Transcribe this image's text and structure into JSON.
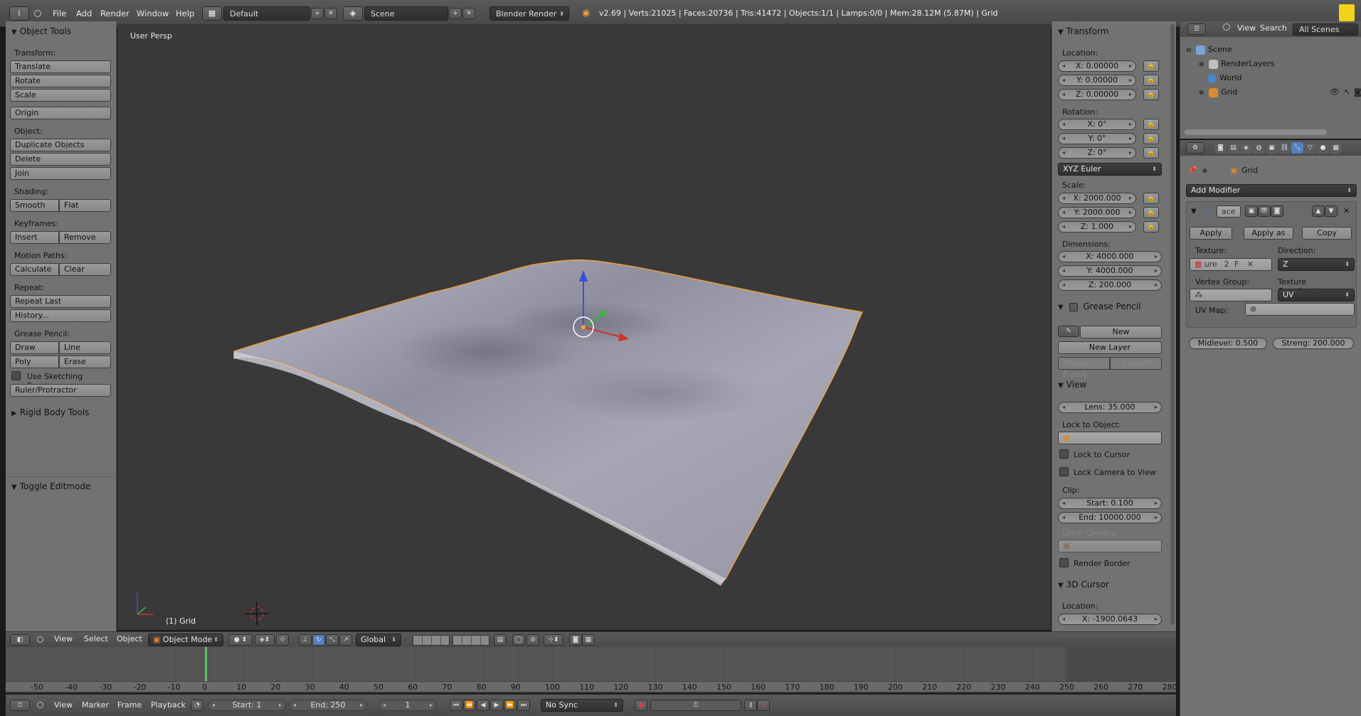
{
  "topbar": {
    "menus": [
      "File",
      "Add",
      "Render",
      "Window",
      "Help"
    ],
    "layout_name": "Default",
    "scene_name": "Scene",
    "render_engine": "Blender Render",
    "stats": "v2.69 | Verts:21025 | Faces:20736 | Tris:41472 | Objects:1/1 | Lamps:0/0 | Mem:28.12M (5.87M) | Grid"
  },
  "left_tools": {
    "title": "Object Tools",
    "transform_label": "Transform:",
    "translate": "Translate",
    "rotate": "Rotate",
    "scale": "Scale",
    "origin": "Origin",
    "object_label": "Object:",
    "duplicate": "Duplicate Objects",
    "delete": "Delete",
    "join": "Join",
    "shading_label": "Shading:",
    "smooth": "Smooth",
    "flat": "Flat",
    "keyframes_label": "Keyframes:",
    "insert": "Insert",
    "remove": "Remove",
    "motion_label": "Motion Paths:",
    "calculate": "Calculate",
    "clear": "Clear",
    "repeat_label": "Repeat:",
    "repeat_last": "Repeat Last",
    "history": "History...",
    "grease_label": "Grease Pencil:",
    "draw": "Draw",
    "line": "Line",
    "poly": "Poly",
    "erase": "Erase",
    "sketching": "Use Sketching Sessions",
    "ruler": "Ruler/Protractor",
    "rigid_body": "Rigid Body Tools",
    "toggle_editmode": "Toggle Editmode"
  },
  "viewport": {
    "label": "User Persp",
    "object": "(1) Grid"
  },
  "transform": {
    "title": "Transform",
    "location_label": "Location:",
    "loc": [
      "X: 0.00000",
      "Y: 0.00000",
      "Z: 0.00000"
    ],
    "rotation_label": "Rotation:",
    "rot": [
      "X: 0°",
      "Y: 0°",
      "Z: 0°"
    ],
    "rotation_mode": "XYZ Euler",
    "scale_label": "Scale:",
    "scale": [
      "X: 2000.000",
      "Y: 2000.000",
      "Z: 1.000"
    ],
    "dimensions_label": "Dimensions:",
    "dims": [
      "X: 4000.000",
      "Y: 4000.000",
      "Z: 200.000"
    ]
  },
  "grease_pencil": {
    "title": "Grease Pencil",
    "new": "New",
    "new_layer": "New Layer",
    "delete_frame": "Delete Frame",
    "convert": "Convert"
  },
  "view_panel": {
    "title": "View",
    "lens": "Lens: 35.000",
    "lock_object_label": "Lock to Object:",
    "lock_cursor": "Lock to Cursor",
    "lock_camera": "Lock Camera to View",
    "clip_label": "Clip:",
    "clip_start": "Start: 0.100",
    "clip_end": "End: 10000.000",
    "local_camera": "Local Camera:",
    "render_border": "Render Border"
  },
  "cursor_panel": {
    "title": "3D Cursor",
    "location_label": "Location:",
    "x": "X: -1900.0643"
  },
  "outliner": {
    "menus": [
      "View",
      "Search"
    ],
    "filter": "All Scenes",
    "rows": [
      "Scene",
      "RenderLayers",
      "World",
      "Grid"
    ]
  },
  "properties": {
    "object_name": "Grid",
    "add_modifier": "Add Modifier",
    "modifier_name": "ace",
    "apply": "Apply",
    "apply_shape": "Apply as Sha",
    "copy": "Copy",
    "texture_label": "Texture:",
    "texture_value": "ure",
    "texture_users": "2",
    "texture_fake": "F",
    "direction_label": "Direction:",
    "direction_value": "Z",
    "vertex_group_label": "Vertex Group:",
    "tex_coords_label": "Texture Coordinates:",
    "tex_coords_value": "UV",
    "uv_map_label": "UV Map:",
    "midlevel": "Midlevel: 0.500",
    "strength": "Streng: 200.000"
  },
  "view3d_header": {
    "menus": [
      "View",
      "Select",
      "Object"
    ],
    "mode": "Object Mode",
    "orientation": "Global"
  },
  "timeline": {
    "ticks": [
      "-50",
      "-40",
      "-30",
      "-20",
      "-10",
      "0",
      "10",
      "20",
      "30",
      "40",
      "50",
      "60",
      "70",
      "80",
      "90",
      "100",
      "110",
      "120",
      "130",
      "140",
      "150",
      "160",
      "170",
      "180",
      "190",
      "200",
      "210",
      "220",
      "230",
      "240",
      "250",
      "260",
      "270",
      "280"
    ],
    "current_frame_marker": 1
  },
  "timeline_header": {
    "menus": [
      "View",
      "Marker",
      "Frame",
      "Playback"
    ],
    "start": "Start: 1",
    "end": "End: 250",
    "current": "1",
    "sync": "No Sync"
  },
  "colors": {
    "accent_blue": "#5680c2",
    "mesh_outline": "#f0a040",
    "frame_green": "#60c060"
  }
}
